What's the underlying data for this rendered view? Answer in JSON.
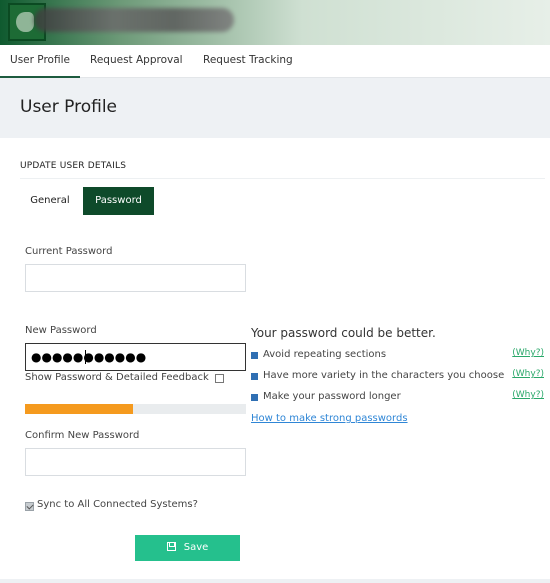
{
  "tabs": [
    {
      "label": "User Profile",
      "active": true
    },
    {
      "label": "Request Approval",
      "active": false
    },
    {
      "label": "Request Tracking",
      "active": false
    }
  ],
  "page": {
    "title": "User Profile"
  },
  "form": {
    "section_title": "UPDATE USER DETAILS",
    "subtabs": [
      {
        "label": "General",
        "active": false
      },
      {
        "label": "Password",
        "active": true
      }
    ],
    "current_password": {
      "label": "Current Password",
      "value": ""
    },
    "new_password": {
      "label": "New Password",
      "value": "●●●●●●●●●●●"
    },
    "show_password": {
      "label": "Show Password & Detailed Feedback",
      "checked": false
    },
    "strength": {
      "fraction": 0.49,
      "color": "#f59a1e"
    },
    "confirm_password": {
      "label": "Confirm New Password",
      "value": ""
    },
    "sync": {
      "label": "Sync to All Connected Systems?",
      "checked": true
    },
    "save_label": "Save"
  },
  "feedback": {
    "title": "Your password could be better.",
    "items": [
      {
        "text": "Avoid repeating sections",
        "why": "(Why?)"
      },
      {
        "text": "Have more variety in the characters you choose",
        "why": "(Why?)"
      },
      {
        "text": "Make your password longer",
        "why": "(Why?)"
      }
    ],
    "link": "How to make strong passwords"
  },
  "colors": {
    "accent_dark": "#0e4a2a",
    "save_button": "#25c08d",
    "link": "#2f86d6",
    "why_link": "#2aa86a",
    "bullet": "#2f6fb3"
  },
  "icons": {
    "save": "floppy-disk-icon",
    "logo": "app-logo"
  }
}
